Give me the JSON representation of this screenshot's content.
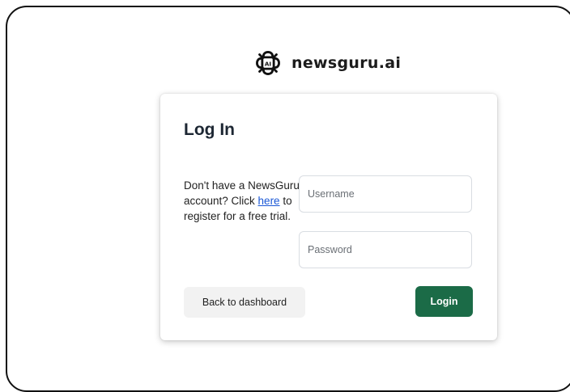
{
  "brand": {
    "logo_icon": "ai-brain-chip-icon",
    "logo_text": "AI",
    "name": "newsguru.ai"
  },
  "login_card": {
    "title": "Log In",
    "signup_prefix": "Don't have a NewsGuru account? Click ",
    "signup_link": "here",
    "signup_suffix": " to register for a free trial.",
    "username_placeholder": "Username",
    "password_placeholder": "Password",
    "back_label": "Back to dashboard",
    "login_label": "Login"
  },
  "colors": {
    "login_button": "#1b6b47",
    "link": "#1a57d6",
    "secondary_button": "#f2f2f2"
  }
}
